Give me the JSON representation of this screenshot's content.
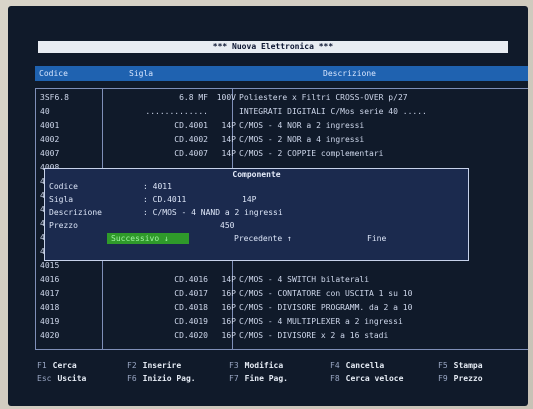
{
  "app": {
    "title": "*** Nuova Elettronica ***"
  },
  "header": {
    "col_code": "Codice",
    "col_sigla": "Sigla",
    "col_desc": "Descrizione"
  },
  "rows": [
    {
      "code": "3SF6.8",
      "sigla": "6.8 MF",
      "val": "100V",
      "desc": "Poliestere x Filtri CROSS-OVER p/27"
    },
    {
      "code": "40",
      "sigla": ".............",
      "val": "",
      "desc": "INTEGRATI DIGITALI C/Mos serie 40 ....."
    },
    {
      "code": "4001",
      "sigla": "CD.4001",
      "val": "14P",
      "desc": "C/MOS - 4 NOR a 2 ingressi"
    },
    {
      "code": "4002",
      "sigla": "CD.4002",
      "val": "14P",
      "desc": "C/MOS - 2 NOR a 4 ingressi"
    },
    {
      "code": "4007",
      "sigla": "CD.4007",
      "val": "14P",
      "desc": "C/MOS - 2 COPPIE complementari"
    },
    {
      "code": "4008",
      "sigla": "",
      "val": "",
      "desc": ""
    },
    {
      "code": "40106",
      "sigla": "",
      "val": "",
      "desc": ""
    },
    {
      "code": "40106",
      "sigla": "",
      "val": "",
      "desc": ""
    },
    {
      "code": "4011",
      "sigla": "",
      "val": "",
      "desc": ""
    },
    {
      "code": "4012",
      "sigla": "",
      "val": "",
      "desc": ""
    },
    {
      "code": "4013",
      "sigla": "",
      "val": "",
      "desc": ""
    },
    {
      "code": "4014",
      "sigla": "",
      "val": "",
      "desc": ""
    },
    {
      "code": "4015",
      "sigla": "",
      "val": "",
      "desc": ""
    },
    {
      "code": "4016",
      "sigla": "CD.4016",
      "val": "14P",
      "desc": "C/MOS - 4 SWITCH bilaterali"
    },
    {
      "code": "4017",
      "sigla": "CD.4017",
      "val": "16P",
      "desc": "C/MOS - CONTATORE con USCITA 1 su 10"
    },
    {
      "code": "4018",
      "sigla": "CD.4018",
      "val": "16P",
      "desc": "C/MOS - DIVISORE PROGRAMM. da 2 a 10"
    },
    {
      "code": "4019",
      "sigla": "CD.4019",
      "val": "16P",
      "desc": "C/MOS - 4 MULTIPLEXER a 2 ingressi"
    },
    {
      "code": "4020",
      "sigla": "CD.4020",
      "val": "16P",
      "desc": "C/MOS - DIVISORE x 2 a 16 stadi"
    }
  ],
  "popup": {
    "title": "Componente",
    "codice_label": "Codice",
    "codice_value": ": 4011",
    "sigla_label": "Sigla",
    "sigla_value": ": CD.4011",
    "sigla_extra": "14P",
    "desc_label": "Descrizione",
    "desc_value": ": C/MOS - 4 NAND a 2 ingressi",
    "prezzo_label": "Prezzo",
    "prezzo_value": "450",
    "btn_next": "Successivo ↓",
    "btn_prev": "Precedente ↑",
    "btn_end": "Fine"
  },
  "footer": {
    "keys": [
      {
        "key": "F1",
        "label": "Cerca"
      },
      {
        "key": "F2",
        "label": "Inserire"
      },
      {
        "key": "F3",
        "label": "Modifica"
      },
      {
        "key": "F4",
        "label": "Cancella"
      },
      {
        "key": "F5",
        "label": "Stampa"
      },
      {
        "key": "Esc",
        "label": "Uscita"
      },
      {
        "key": "F6",
        "label": "Inizio Pag."
      },
      {
        "key": "F7",
        "label": "Fine Pag."
      },
      {
        "key": "F8",
        "label": "Cerca veloce"
      },
      {
        "key": "F9",
        "label": "Prezzo"
      }
    ]
  },
  "colors": {
    "screen": "#101a2a",
    "header": "#1f62b0",
    "popup": "#1b2a4e",
    "active_button": "#2f9a2a"
  }
}
